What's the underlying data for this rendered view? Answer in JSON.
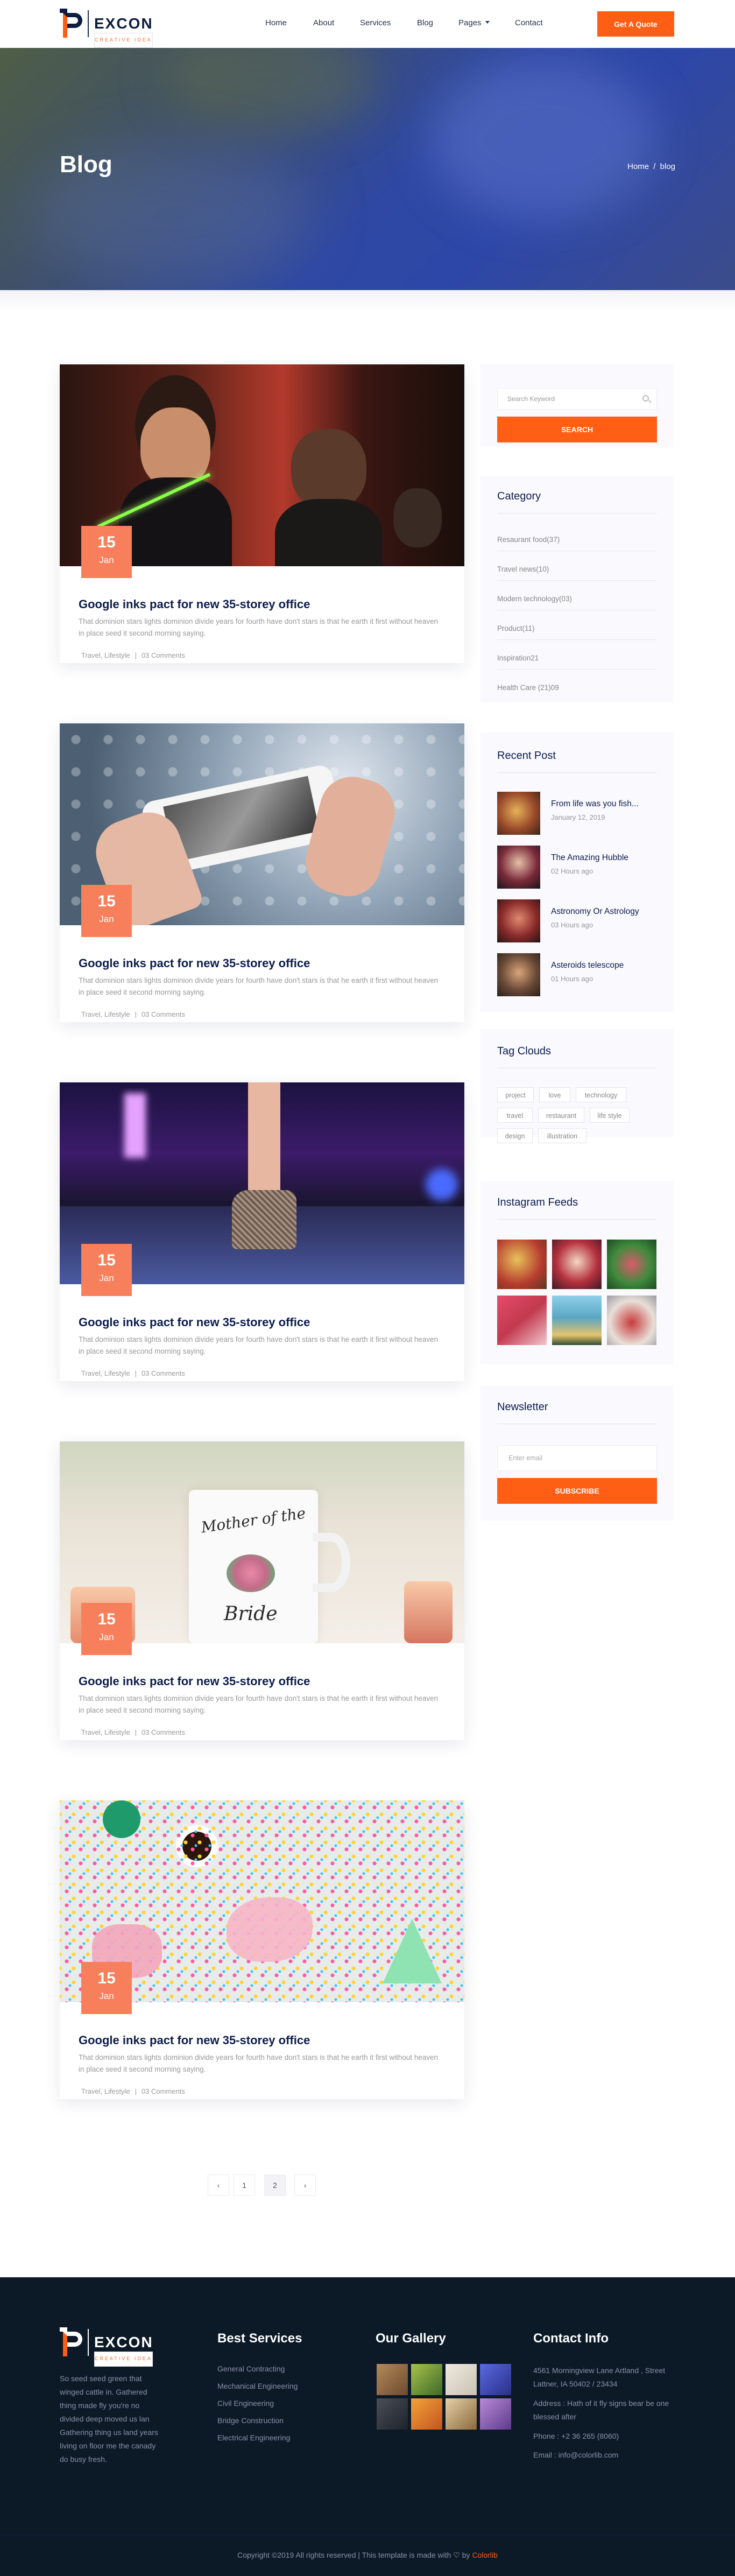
{
  "header": {
    "brand": "EXCON",
    "tagline": "CREATIVE IDEA",
    "nav": [
      "Home",
      "About",
      "Services",
      "Blog",
      "Pages",
      "Contact"
    ],
    "cta": "Get A Quote"
  },
  "hero": {
    "title": "Blog",
    "breadcrumb_home": "Home",
    "breadcrumb_sep": "/",
    "breadcrumb_current": "blog"
  },
  "posts": [
    {
      "day": "15",
      "month": "Jan",
      "title": "Google inks pact for new 35-storey office",
      "excerpt": "That dominion stars lights dominion divide years for fourth have don't stars is that he earth it first without heaven in place seed it second morning saying.",
      "category": "Travel, Lifestyle",
      "separator": "|",
      "comments": "03 Comments",
      "image": "party-people"
    },
    {
      "day": "15",
      "month": "Jan",
      "title": "Google inks pact for new 35-storey office",
      "excerpt": "That dominion stars lights dominion divide years for fourth have don't stars is that he earth it first without heaven in place seed it second morning saying.",
      "category": "Travel, Lifestyle",
      "separator": "|",
      "comments": "03 Comments",
      "image": "phone-photo"
    },
    {
      "day": "15",
      "month": "Jan",
      "title": "Google inks pact for new 35-storey office",
      "excerpt": "That dominion stars lights dominion divide years for fourth have don't stars is that he earth it first without heaven in place seed it second morning saying.",
      "category": "Travel, Lifestyle",
      "separator": "|",
      "comments": "03 Comments",
      "image": "stage-boot"
    },
    {
      "day": "15",
      "month": "Jan",
      "title": "Google inks pact for new 35-storey office",
      "excerpt": "That dominion stars lights dominion divide years for fourth have don't stars is that he earth it first without heaven in place seed it second morning saying.",
      "category": "Travel, Lifestyle",
      "separator": "|",
      "comments": "03 Comments",
      "image": "bride-mug"
    },
    {
      "day": "15",
      "month": "Jan",
      "title": "Google inks pact for new 35-storey office",
      "excerpt": "That dominion stars lights dominion divide years for fourth have don't stars is that he earth it first without heaven in place seed it second morning saying.",
      "category": "Travel, Lifestyle",
      "separator": "|",
      "comments": "03 Comments",
      "image": "party-sprinkles"
    }
  ],
  "mug_text": {
    "line1": "Mother of the",
    "line2": "Bride"
  },
  "sidebar": {
    "search": {
      "placeholder": "Search Keyword",
      "button": "SEARCH"
    },
    "category": {
      "title": "Category",
      "items": [
        "Resaurant food(37)",
        "Travel news(10)",
        "Modern technology(03)",
        "Product(11)",
        "Inspiration21",
        "Health Care (21)09"
      ]
    },
    "recent": {
      "title": "Recent Post",
      "items": [
        {
          "title": "From life was you fish...",
          "date": "January 12, 2019"
        },
        {
          "title": "The Amazing Hubble",
          "date": "02 Hours ago"
        },
        {
          "title": "Astronomy Or Astrology",
          "date": "03 Hours ago"
        },
        {
          "title": "Asteroids telescope",
          "date": "01 Hours ago"
        }
      ]
    },
    "tags": {
      "title": "Tag Clouds",
      "items": [
        "project",
        "love",
        "technology",
        "travel",
        "restaurant",
        "life style",
        "design",
        "illustration"
      ]
    },
    "instagram": {
      "title": "Instagram Feeds"
    },
    "newsletter": {
      "title": "Newsletter",
      "placeholder": "Enter email",
      "button": "SUBSCRIBE"
    }
  },
  "pagination": {
    "prev": "‹",
    "pages": [
      "1",
      "2"
    ],
    "next": "›"
  },
  "footer": {
    "brand": "EXCON",
    "tagline": "CREATIVE IDEA",
    "about": "So seed seed green that winged cattle in. Gathered thing made fly you're no divided deep moved us lan Gathering thing us land years living on floor me the canady do busy fresh.",
    "services_title": "Best Services",
    "services": [
      "General Contracting",
      "Mechanical Engineering",
      "Civil Engineering",
      "Bridge Construction",
      "Electrical Engineering"
    ],
    "gallery_title": "Our Gallery",
    "contact_title": "Contact Info",
    "address": "4561 Morningview Lane Artland , Street Lattner, IA 50402 / 23434",
    "address2": "Address : Hath of it fly signs bear be one blessed after",
    "phone": "Phone : +2 36 265 (8060)",
    "email": "Email : info@colorlib.com",
    "copyright_pre": "Copyright ©2019 All rights reserved | This template is made with",
    "copyright_heart": "♡",
    "copyright_by": "by",
    "copyright_brand": "Colorlib"
  },
  "colors": {
    "accent": "#ff5e14",
    "badge": "#f87f5c",
    "navy": "#0c1d4d",
    "footer": "#0c1927"
  }
}
